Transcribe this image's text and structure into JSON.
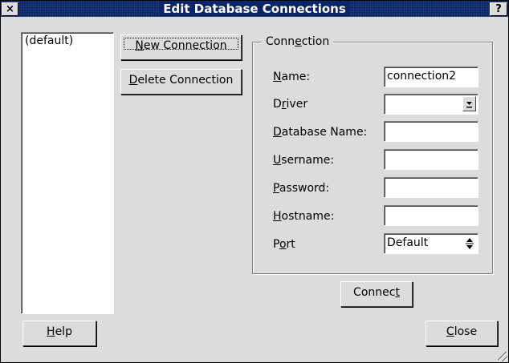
{
  "window": {
    "title": "Edit Database Connections",
    "close_glyph": "×",
    "help_glyph": "?"
  },
  "connections_list": {
    "items": [
      "(default)"
    ]
  },
  "buttons": {
    "new_connection": {
      "mn": "N",
      "rest": "ew Connection"
    },
    "delete_connection": {
      "mn": "D",
      "rest": "elete Connection"
    },
    "connect": {
      "pre": "Connec",
      "mn": "t",
      "rest": ""
    },
    "help": {
      "mn": "H",
      "rest": "elp"
    },
    "close": {
      "mn": "C",
      "rest": "lose"
    }
  },
  "group": {
    "pre": "Conn",
    "mn": "e",
    "rest": "ction"
  },
  "form": {
    "name": {
      "pre": "",
      "mn": "N",
      "rest": "ame:",
      "value": "connection2"
    },
    "driver": {
      "pre": "D",
      "mn": "r",
      "rest": "iver",
      "value": ""
    },
    "database": {
      "pre": "",
      "mn": "D",
      "rest": "atabase Name:",
      "value": ""
    },
    "username": {
      "pre": "",
      "mn": "U",
      "rest": "sername:",
      "value": ""
    },
    "password": {
      "pre": "",
      "mn": "P",
      "rest": "assword:",
      "value": ""
    },
    "hostname": {
      "pre": "",
      "mn": "H",
      "rest": "ostname:",
      "value": ""
    },
    "port": {
      "pre": "P",
      "mn": "o",
      "rest": "rt",
      "value": "Default"
    }
  }
}
